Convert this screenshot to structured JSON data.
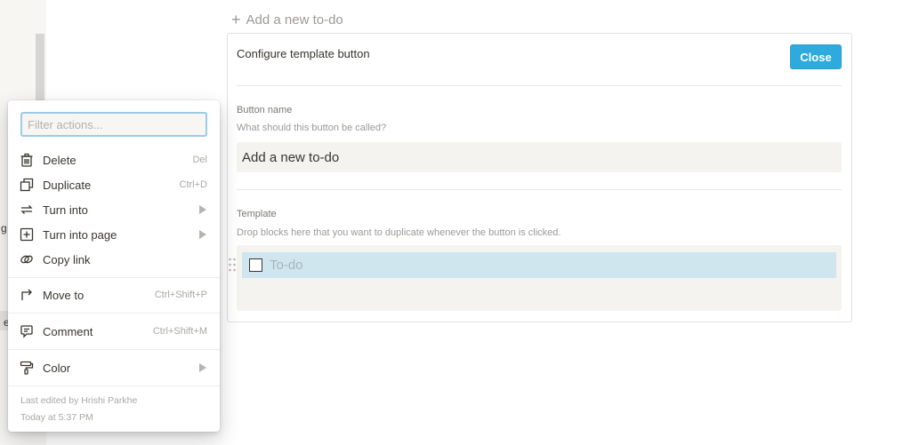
{
  "page": {
    "add_todo_label": "Add a new to-do",
    "sidebar_fragments": [
      "g",
      "e"
    ]
  },
  "config": {
    "title": "Configure template button",
    "close_label": "Close",
    "button_name_label": "Button name",
    "button_name_hint": "What should this button be called?",
    "button_name_value": "Add a new to-do",
    "template_label": "Template",
    "template_hint": "Drop blocks here that you want to duplicate whenever the button is clicked.",
    "todo_placeholder": "To-do"
  },
  "menu": {
    "filter_placeholder": "Filter actions...",
    "items": [
      {
        "label": "Delete",
        "shortcut": "Del",
        "icon": "trash-icon"
      },
      {
        "label": "Duplicate",
        "shortcut": "Ctrl+D",
        "icon": "duplicate-icon"
      },
      {
        "label": "Turn into",
        "shortcut": "",
        "icon": "turn-into-icon",
        "submenu": true
      },
      {
        "label": "Turn into page",
        "shortcut": "",
        "icon": "page-plus-icon",
        "submenu": true
      },
      {
        "label": "Copy link",
        "shortcut": "",
        "icon": "link-icon"
      },
      {
        "label": "Move to",
        "shortcut": "Ctrl+Shift+P",
        "icon": "move-arrow-icon"
      },
      {
        "label": "Comment",
        "shortcut": "Ctrl+Shift+M",
        "icon": "comment-icon"
      },
      {
        "label": "Color",
        "shortcut": "",
        "icon": "paint-roller-icon",
        "submenu": true
      }
    ],
    "footer_edited_by": "Last edited by Hrishi Parkhe",
    "footer_time": "Today at 5:37 PM"
  },
  "colors": {
    "accent": "#2eaadc",
    "selected_block": "#cfe6ee",
    "input_bg": "#f4f3f0"
  }
}
